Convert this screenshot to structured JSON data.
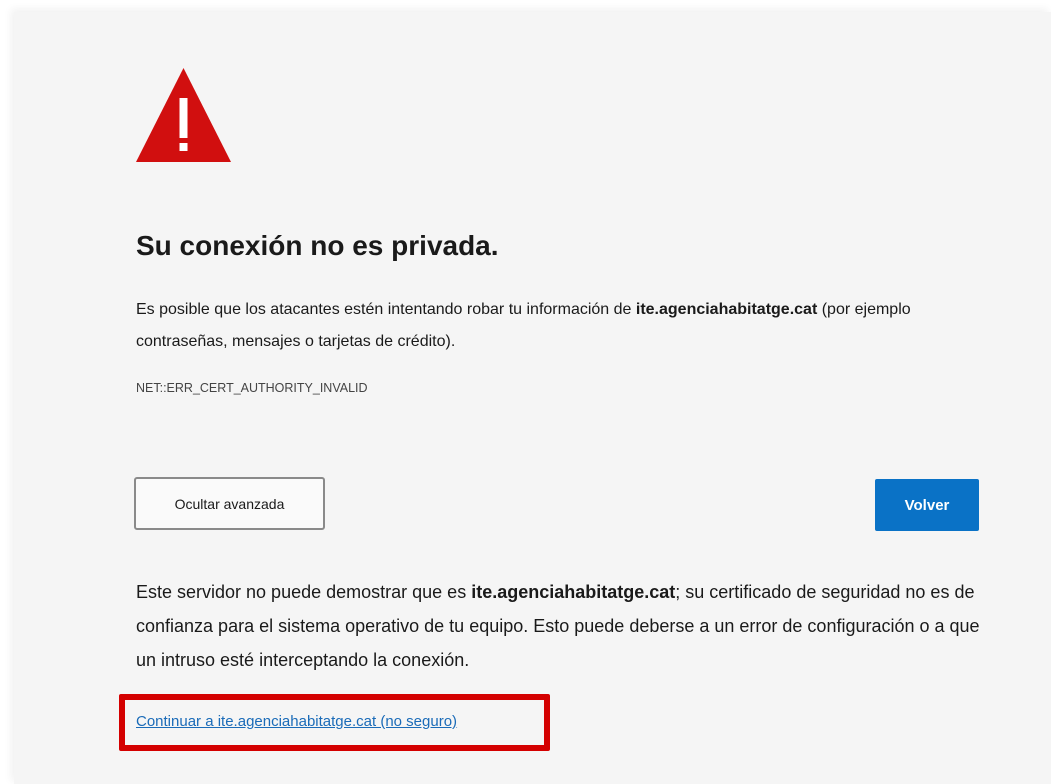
{
  "warning_icon": {
    "icon": "warning-triangle-icon",
    "color": "#d10f0f"
  },
  "title": "Su conexión no es privada.",
  "intro": {
    "before": "Es posible que los atacantes estén intentando robar tu información de ",
    "host": "ite.agenciahabitatge.cat",
    "after": " (por ejemplo contraseñas, mensajes o tarjetas de crédito)."
  },
  "error_code": "NET::ERR_CERT_AUTHORITY_INVALID",
  "buttons": {
    "advanced_label": "Ocultar avanzada",
    "back_label": "Volver",
    "back_color": "#0a72c6"
  },
  "details": {
    "before": "Este servidor no puede demostrar que es ",
    "host": "ite.agenciahabitatge.cat",
    "after": "; su certificado de seguridad no es de confianza para el sistema operativo de tu equipo. Esto puede deberse a un error de configuración o a que un intruso esté interceptando la conexión."
  },
  "proceed_link": "Continuar a ite.agenciahabitatge.cat (no seguro)",
  "highlight_color": "#d40000"
}
